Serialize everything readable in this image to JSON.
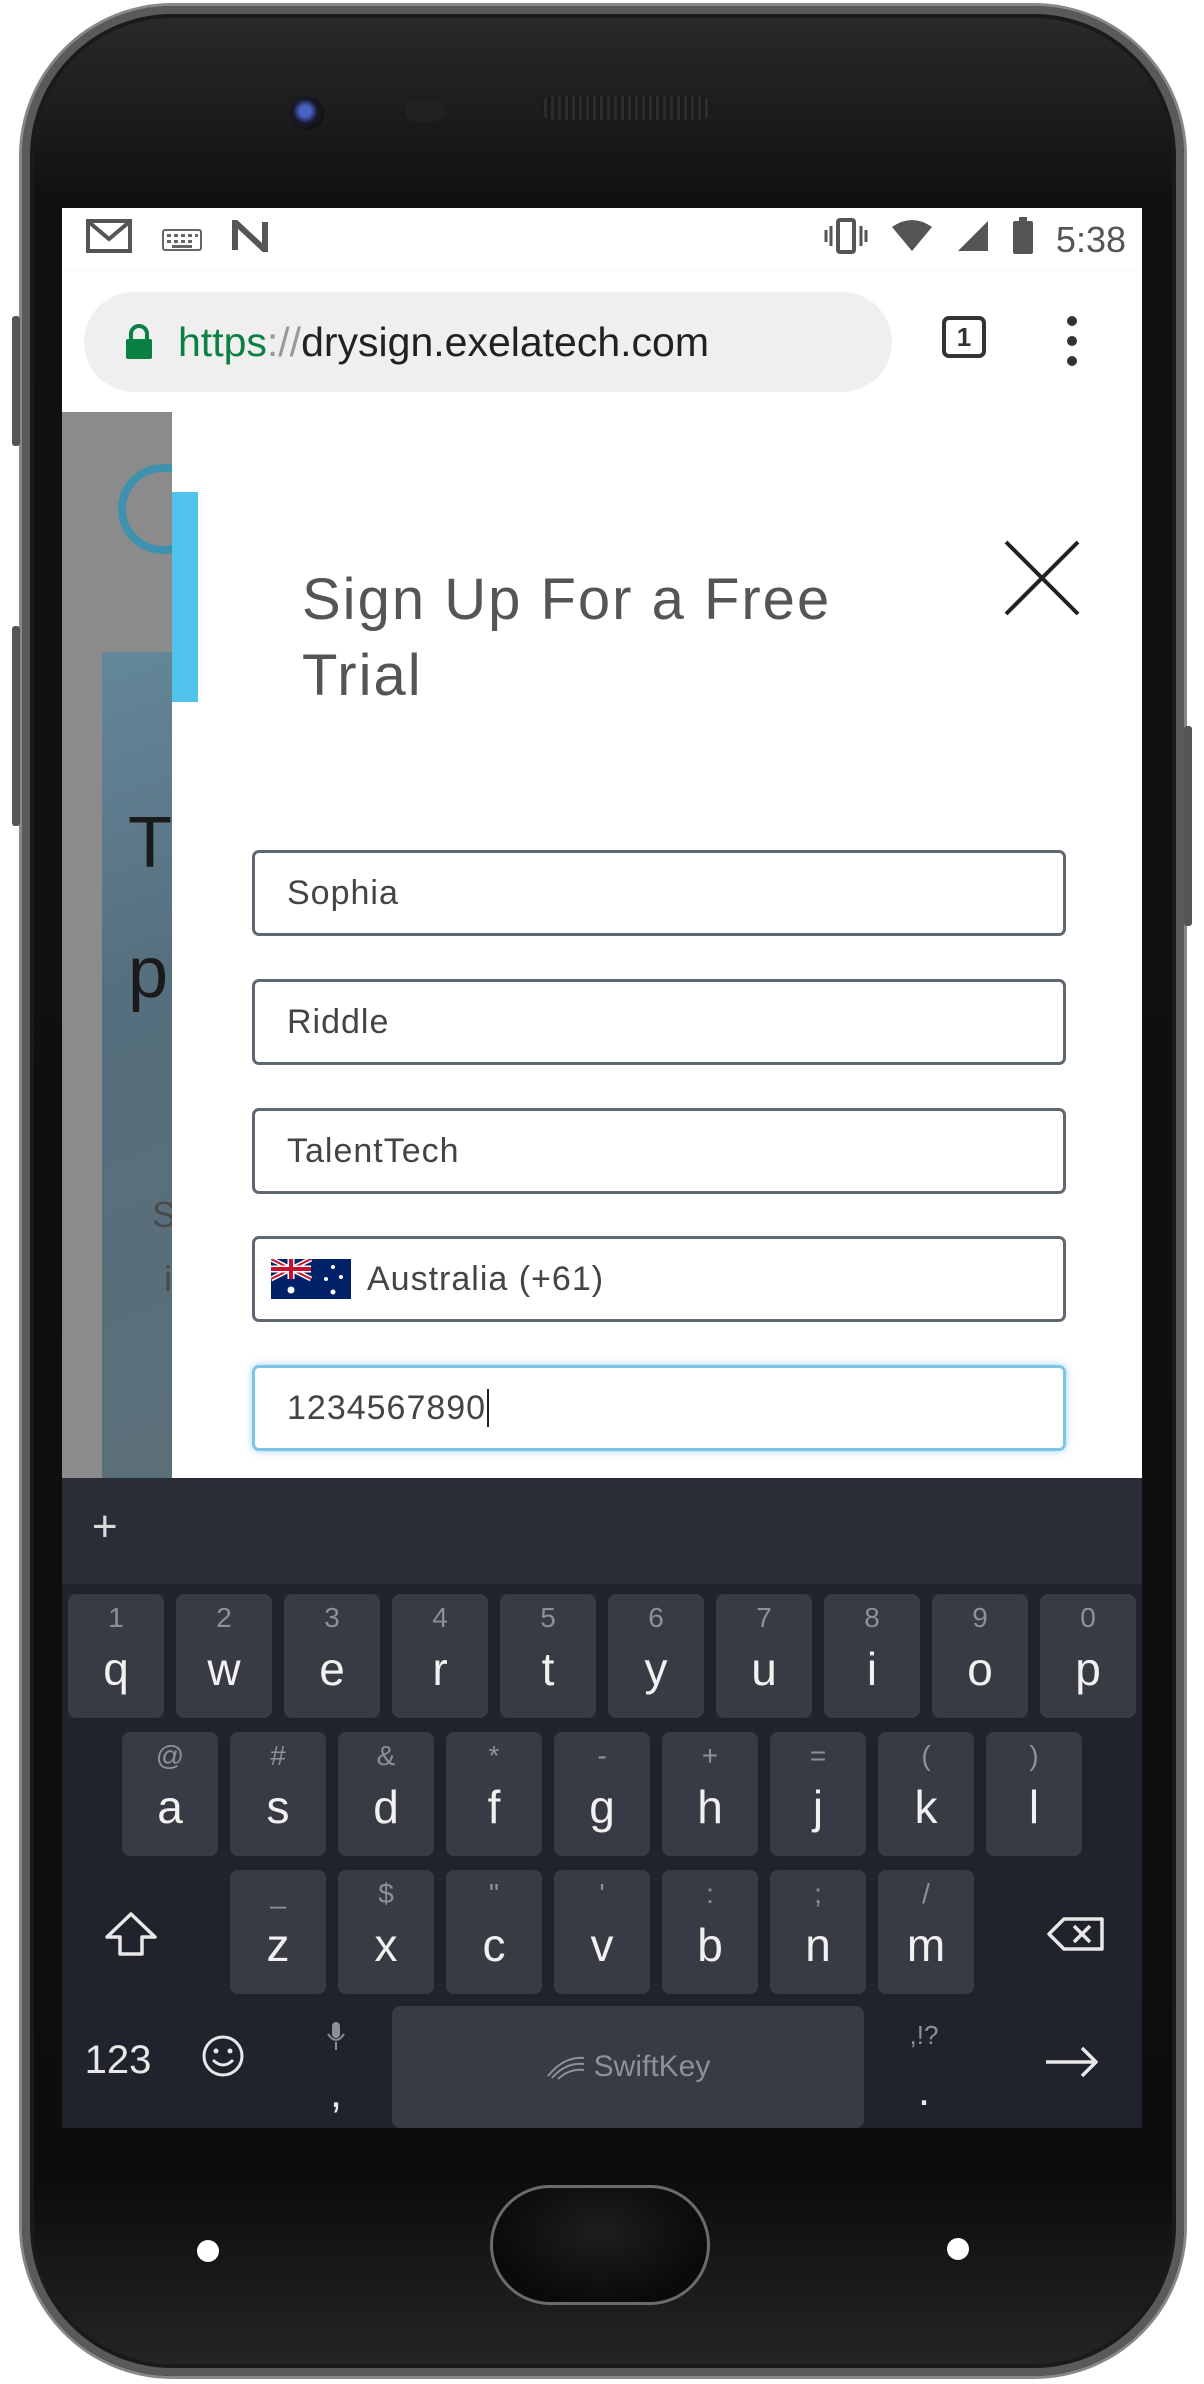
{
  "status_bar": {
    "time": "5:38",
    "left_icons": [
      "gmail-icon",
      "keyboard-icon",
      "n-icon"
    ],
    "right_icons": [
      "vibrate-icon",
      "wifi-icon",
      "signal-icon",
      "battery-icon"
    ]
  },
  "browser": {
    "url_scheme": "https",
    "url_sep": "://",
    "url_host": "drysign.exelatech.com",
    "tab_count": "1",
    "lock_color": "#0b8043"
  },
  "background_page": {
    "heading_line1": "T",
    "heading_line2": "p",
    "text_line1": "S",
    "text_line2": "i"
  },
  "modal": {
    "title": "Sign Up For a Free Trial",
    "accent_color": "#4fc3ea",
    "fields": {
      "first_name": "Sophia",
      "last_name": "Riddle",
      "company": "TalentTech",
      "country": "Australia (+61)",
      "phone": "1234567890"
    }
  },
  "keyboard": {
    "toolbar_plus": "+",
    "row1": [
      {
        "hint": "1",
        "key": "q"
      },
      {
        "hint": "2",
        "key": "w"
      },
      {
        "hint": "3",
        "key": "e"
      },
      {
        "hint": "4",
        "key": "r"
      },
      {
        "hint": "5",
        "key": "t"
      },
      {
        "hint": "6",
        "key": "y"
      },
      {
        "hint": "7",
        "key": "u"
      },
      {
        "hint": "8",
        "key": "i"
      },
      {
        "hint": "9",
        "key": "o"
      },
      {
        "hint": "0",
        "key": "p"
      }
    ],
    "row2": [
      {
        "hint": "@",
        "key": "a"
      },
      {
        "hint": "#",
        "key": "s"
      },
      {
        "hint": "&",
        "key": "d"
      },
      {
        "hint": "*",
        "key": "f"
      },
      {
        "hint": "-",
        "key": "g"
      },
      {
        "hint": "+",
        "key": "h"
      },
      {
        "hint": "=",
        "key": "j"
      },
      {
        "hint": "(",
        "key": "k"
      },
      {
        "hint": ")",
        "key": "l"
      }
    ],
    "row3": [
      {
        "hint": "_",
        "key": "z"
      },
      {
        "hint": "$",
        "key": "x"
      },
      {
        "hint": "\"",
        "key": "c"
      },
      {
        "hint": "'",
        "key": "v"
      },
      {
        "hint": ":",
        "key": "b"
      },
      {
        "hint": ";",
        "key": "n"
      },
      {
        "hint": "/",
        "key": "m"
      }
    ],
    "num_label": "123",
    "comma": ",",
    "period": ".",
    "period_hint": ",!?",
    "space_label": "SwiftKey"
  }
}
